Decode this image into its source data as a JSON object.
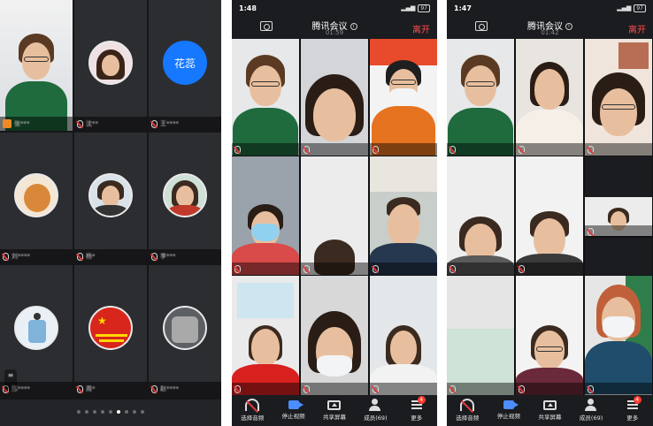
{
  "screens": [
    {
      "id": "gallery-avatars",
      "tiles": [
        {
          "name": "张***",
          "avatar": "photo",
          "host": true
        },
        {
          "name": "沈**",
          "avatar": "photo"
        },
        {
          "name": "王****",
          "avatar_text": "花蕊",
          "avatar_bg": "#1677ff"
        },
        {
          "name": "刘****",
          "avatar": "photo"
        },
        {
          "name": "杨*",
          "avatar": "photo"
        },
        {
          "name": "李***",
          "avatar": "photo"
        },
        {
          "name": "陈****",
          "avatar": "photo"
        },
        {
          "name": "周*",
          "avatar": "photo"
        },
        {
          "name": "赵****",
          "avatar": "photo"
        }
      ],
      "page_dots": 9,
      "active_dot": 5
    },
    {
      "id": "video-grid-1",
      "status": {
        "time": "1:48",
        "battery": "97"
      },
      "header": {
        "title": "腾讯会议",
        "timer": "01:59",
        "leave": "离开"
      }
    },
    {
      "id": "video-grid-2",
      "status": {
        "time": "1:47",
        "battery": "97"
      },
      "header": {
        "title": "腾讯会议",
        "timer": "01:42",
        "leave": "离开"
      }
    }
  ],
  "toolbar": [
    {
      "label": "选择音频",
      "icon": "headset-muted-icon"
    },
    {
      "label": "停止视频",
      "icon": "video-camera-icon"
    },
    {
      "label": "共享屏幕",
      "icon": "share-screen-icon"
    },
    {
      "label": "成员(69)",
      "icon": "members-icon"
    },
    {
      "label": "更多",
      "icon": "more-icon",
      "badge": "4"
    }
  ],
  "colors": {
    "background": "#1b1c1f",
    "accent": "#4c8dff",
    "leave": "#ff4d4f"
  }
}
